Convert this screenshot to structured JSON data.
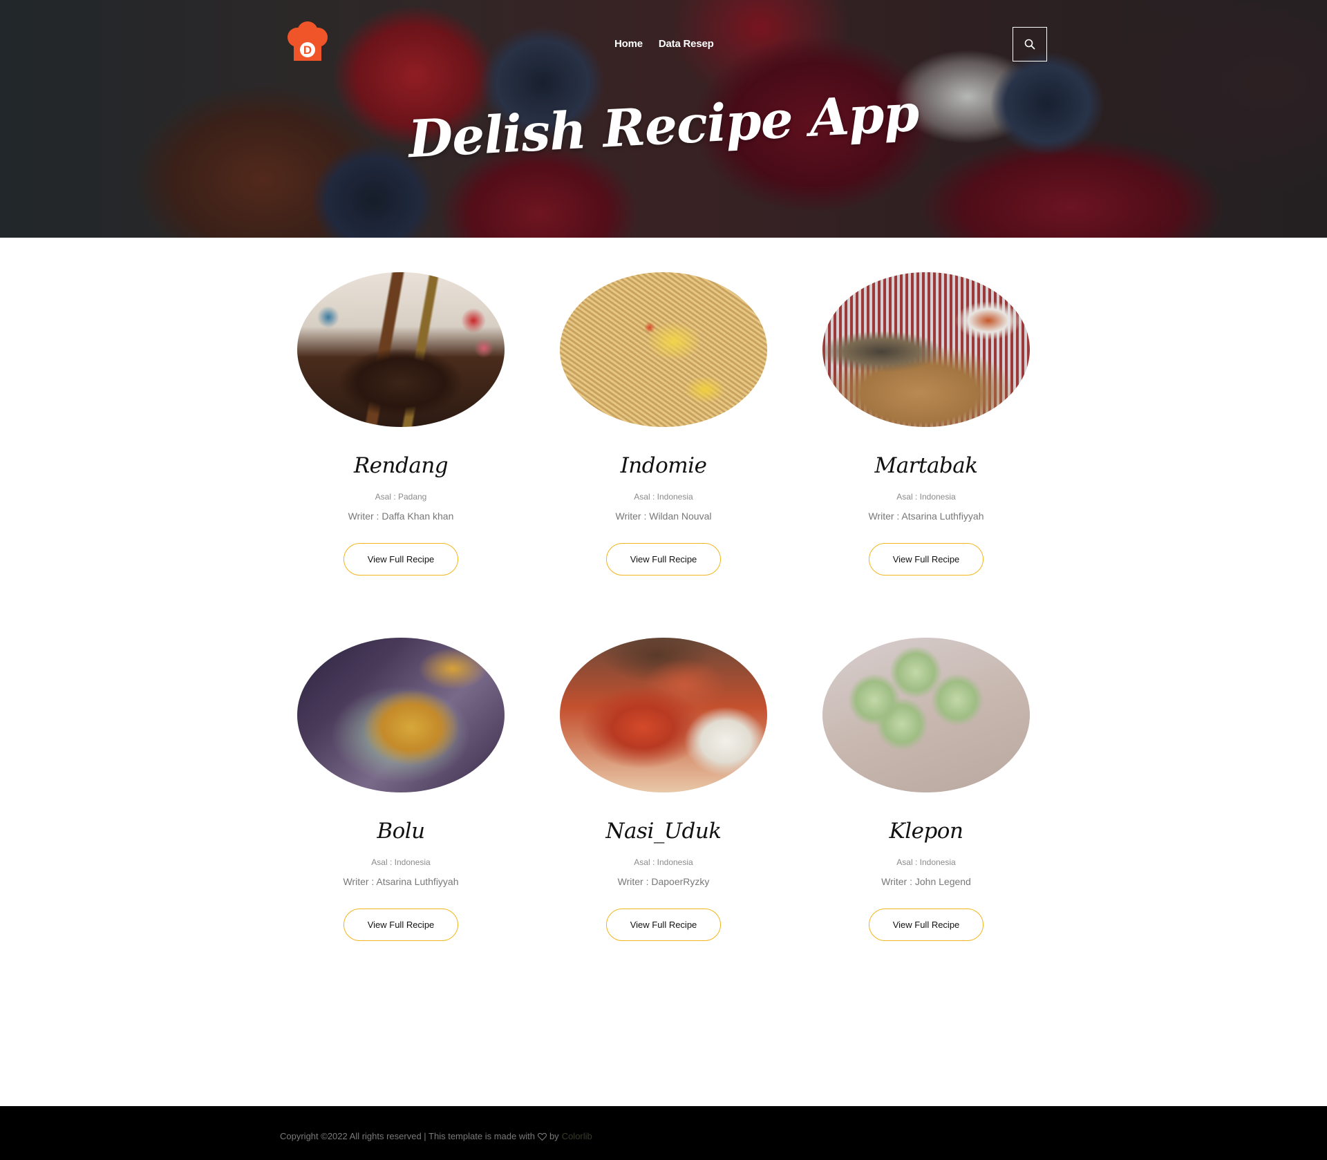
{
  "header": {
    "logo_letter": "D",
    "nav": [
      {
        "label": "Home"
      },
      {
        "label": "Data Resep"
      }
    ],
    "search_icon": "search-icon"
  },
  "hero": {
    "title": "Delish Recipe App"
  },
  "recipes": [
    {
      "name": "Rendang",
      "origin": "Asal : Padang",
      "writer": "Writer : Daffa Khan khan",
      "button": "View Full Recipe"
    },
    {
      "name": "Indomie",
      "origin": "Asal : Indonesia",
      "writer": "Writer : Wildan Nouval",
      "button": "View Full Recipe"
    },
    {
      "name": "Martabak",
      "origin": "Asal : Indonesia",
      "writer": "Writer : Atsarina Luthfiyyah",
      "button": "View Full Recipe"
    },
    {
      "name": "Bolu",
      "origin": "Asal : Indonesia",
      "writer": "Writer : Atsarina Luthfiyyah",
      "button": "View Full Recipe"
    },
    {
      "name": "Nasi_Uduk",
      "origin": "Asal : Indonesia",
      "writer": "Writer : DapoerRyzky",
      "button": "View Full Recipe"
    },
    {
      "name": "Klepon",
      "origin": "Asal : Indonesia",
      "writer": "Writer : John Legend",
      "button": "View Full Recipe"
    }
  ],
  "footer": {
    "text": "Copyright ©2022 All rights reserved | This template is made with",
    "by": "by",
    "link": "Colorlib"
  },
  "colors": {
    "accent": "#f2b51c",
    "logo": "#f0552a",
    "footer_bg": "#000000"
  }
}
